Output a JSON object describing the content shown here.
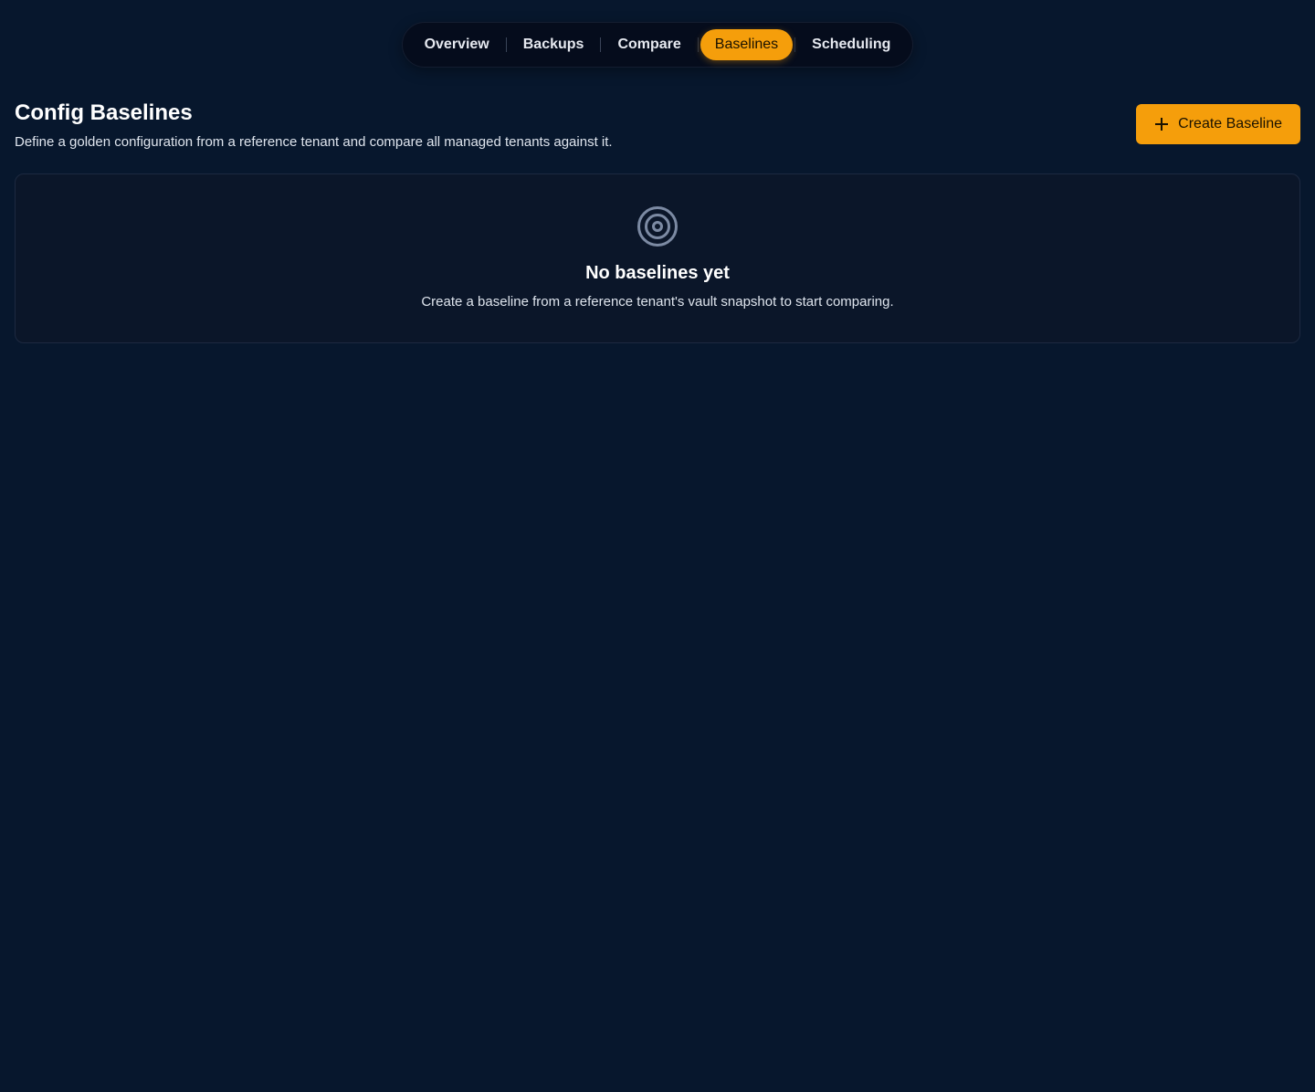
{
  "nav": {
    "tabs": [
      {
        "label": "Overview"
      },
      {
        "label": "Backups"
      },
      {
        "label": "Compare"
      },
      {
        "label": "Baselines"
      },
      {
        "label": "Scheduling"
      }
    ],
    "active_tab": "Baselines"
  },
  "header": {
    "title": "Config Baselines",
    "subtitle": "Define a golden configuration from a reference tenant and compare all managed tenants against it.",
    "create_button_label": "Create Baseline",
    "create_button_icon": "plus-icon"
  },
  "empty_state": {
    "icon": "target-icon",
    "title": "No baselines yet",
    "message": "Create a baseline from a reference tenant's vault snapshot to start comparing."
  },
  "colors": {
    "background": "#07172d",
    "accent": "#f59e0b",
    "card": "#0b1629",
    "icon": "#7c8aa3"
  }
}
